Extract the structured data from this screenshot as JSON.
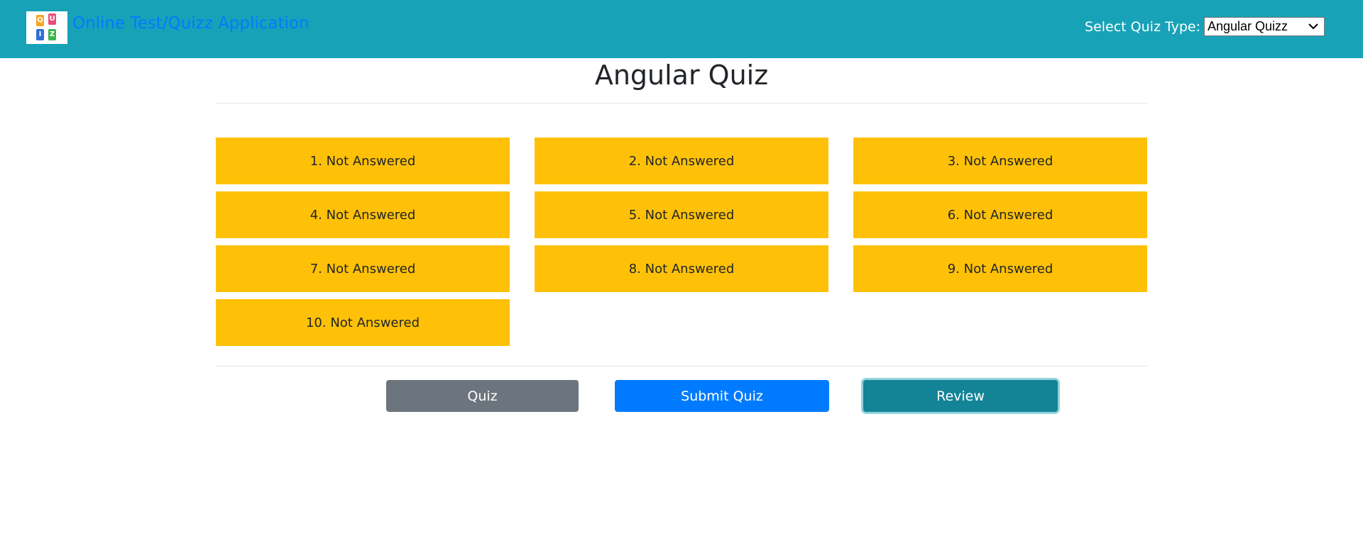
{
  "header": {
    "brand_text": "Online Test/Quizz Application",
    "logo_letters": [
      "Q",
      "U",
      "I",
      "Z"
    ],
    "quiz_type_label": "Select Quiz Type:",
    "quiz_type_selected": "Angular Quizz"
  },
  "main": {
    "title": "Angular Quiz",
    "questions": [
      {
        "label": "1. Not Answered"
      },
      {
        "label": "2. Not Answered"
      },
      {
        "label": "3. Not Answered"
      },
      {
        "label": "4. Not Answered"
      },
      {
        "label": "5. Not Answered"
      },
      {
        "label": "6. Not Answered"
      },
      {
        "label": "7. Not Answered"
      },
      {
        "label": "8. Not Answered"
      },
      {
        "label": "9. Not Answered"
      },
      {
        "label": "10. Not Answered"
      }
    ]
  },
  "actions": {
    "quiz_label": "Quiz",
    "submit_label": "Submit Quiz",
    "review_label": "Review"
  },
  "colors": {
    "navbar": "#17a2b8",
    "brand": "#007bff",
    "not_answered": "#ffc107",
    "quiz_button": "#6c757d",
    "submit_button": "#007bff",
    "review_button": "#138496"
  }
}
